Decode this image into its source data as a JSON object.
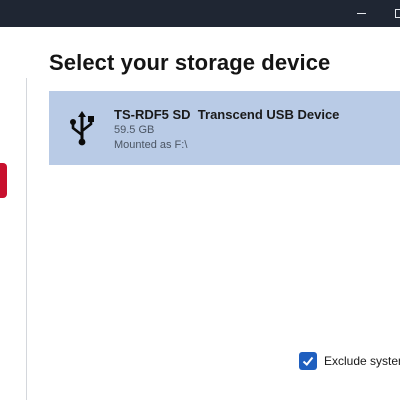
{
  "window": {
    "controls": {
      "minimize_icon": "minimize-icon",
      "maximize_icon": "maximize-icon"
    },
    "titlebar_color": "#1f2633"
  },
  "sidebar": {
    "active_tab_color": "#c8102e"
  },
  "main": {
    "title": "Select your storage device",
    "devices": [
      {
        "icon": "usb-icon",
        "name": "TS-RDF5 SD  Transcend USB Device",
        "size": "59.5 GB",
        "mount": "Mounted as F:\\",
        "selected": true,
        "highlight_color": "#b9cbe6"
      }
    ],
    "exclude_option": {
      "label": "Exclude system",
      "checked": true,
      "checkbox_color": "#1f5fbf"
    }
  }
}
